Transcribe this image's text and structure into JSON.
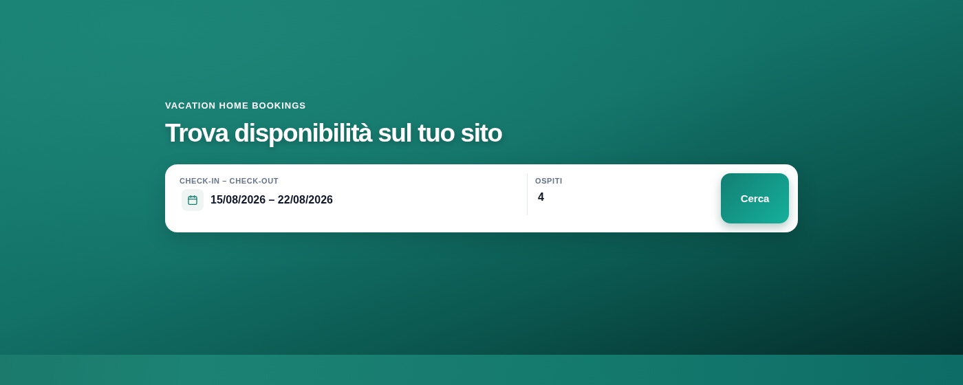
{
  "hero": {
    "eyebrow": "VACATION HOME BOOKINGS",
    "title": "Trova disponibilità sul tuo sito"
  },
  "search_form": {
    "fields": [
      {
        "kind": "daterange",
        "label": "CHECK-IN – CHECK-OUT",
        "value": "15/08/2026 – 22/08/2026"
      },
      {
        "kind": "number",
        "label": "OSPITI",
        "value": "4"
      }
    ],
    "button": "Cerca"
  }
}
